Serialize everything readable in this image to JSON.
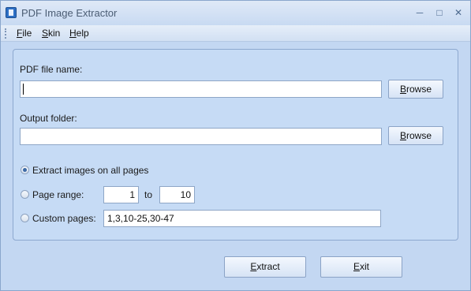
{
  "window": {
    "title": "PDF Image Extractor",
    "icon": "app-pdf-icon",
    "controls": {
      "minimize": "─",
      "maximize": "□",
      "close": "✕"
    }
  },
  "menu": {
    "items": [
      "File",
      "Skin",
      "Help"
    ]
  },
  "form": {
    "pdf_label": "PDF file name:",
    "pdf_value": "",
    "pdf_browse": "Browse",
    "output_label": "Output folder:",
    "output_value": "",
    "output_browse": "Browse",
    "options": {
      "all_pages": {
        "label": "Extract images on all pages",
        "checked": true
      },
      "page_range": {
        "label": "Page range:",
        "checked": false,
        "from": "1",
        "to_label": "to",
        "to": "10"
      },
      "custom_pages": {
        "label": "Custom pages:",
        "checked": false,
        "value": "1,3,10-25,30-47"
      }
    }
  },
  "buttons": {
    "extract": "Extract",
    "exit": "Exit"
  },
  "colors": {
    "window_bg": "#c3d7f2",
    "border": "#8da8cf",
    "radio_dot": "#3d6aa6"
  }
}
